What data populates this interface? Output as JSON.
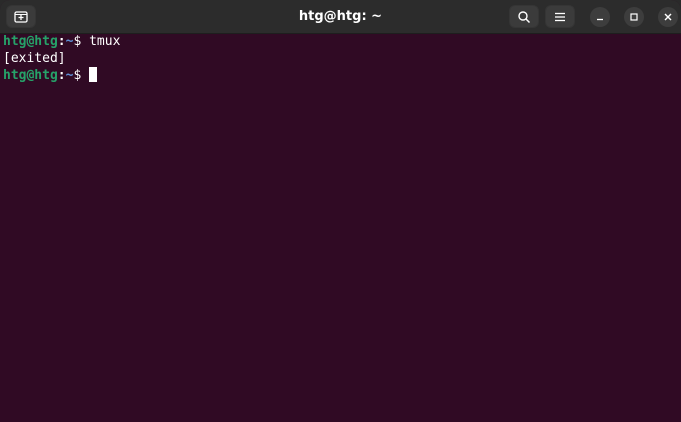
{
  "window": {
    "title": "htg@htg: ~"
  },
  "titlebar": {
    "new_tab_icon": "new-tab-icon",
    "search_icon": "search-icon",
    "menu_icon": "hamburger-menu-icon",
    "minimize_icon": "minimize-icon",
    "maximize_icon": "maximize-icon",
    "close_icon": "close-icon"
  },
  "terminal": {
    "lines": [
      {
        "user_host": "htg@htg",
        "separator": ":",
        "path": "~",
        "prompt": "$ ",
        "command": "tmux"
      },
      {
        "output": "[exited]"
      },
      {
        "user_host": "htg@htg",
        "separator": ":",
        "path": "~",
        "prompt": "$ ",
        "command": ""
      }
    ]
  },
  "colors": {
    "terminal_background": "#300a24",
    "prompt_user": "#26a269",
    "prompt_path": "#5e8fd6",
    "titlebar": "#2c2c2c"
  }
}
